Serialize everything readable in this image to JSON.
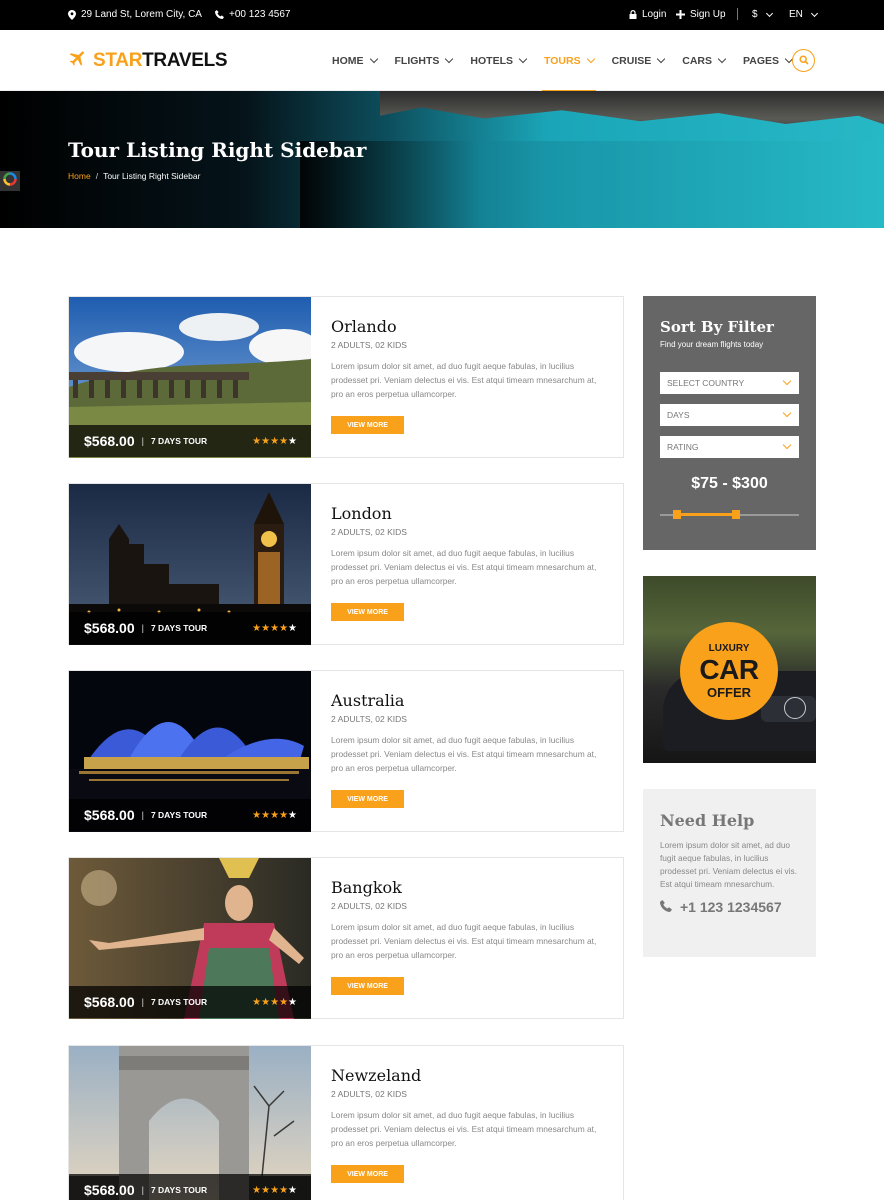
{
  "topbar": {
    "address": "29 Land St, Lorem City, CA",
    "phone": "+00 123 4567",
    "login": "Login",
    "signup": "Sign Up",
    "currency": "$",
    "language": "EN"
  },
  "brand": {
    "part1": "STAR",
    "part2": "TRAVELS"
  },
  "nav": [
    "HOME",
    "FLIGHTS",
    "HOTELS",
    "TOURS",
    "CRUISE",
    "CARS",
    "PAGES"
  ],
  "nav_active": "TOURS",
  "hero": {
    "title": "Tour Listing Right Sidebar",
    "breadcrumb_home": "Home",
    "breadcrumb_sep": "/",
    "breadcrumb_current": "Tour Listing Right Sidebar"
  },
  "tours": [
    {
      "city": "Orlando",
      "guests": "2 ADULTS, 02 KIDS",
      "price": "$568.00",
      "sep": "|",
      "duration": "7 DAYS TOUR",
      "rating": 4,
      "max_rating": 5,
      "button": "VIEW MORE",
      "description": "Lorem ipsum dolor sit amet, ad duo fugit aeque fabulas, in lucilius prodesset pri. Veniam delectus ei vis. Est atqui timeam mnesarchum at, pro an eros perpetua ullamcorper."
    },
    {
      "city": "London",
      "guests": "2 ADULTS, 02 KIDS",
      "price": "$568.00",
      "sep": "|",
      "duration": "7 DAYS TOUR",
      "rating": 4,
      "max_rating": 5,
      "button": "VIEW MORE",
      "description": "Lorem ipsum dolor sit amet, ad duo fugit aeque fabulas, in lucilius prodesset pri. Veniam delectus ei vis. Est atqui timeam mnesarchum at, pro an eros perpetua ullamcorper."
    },
    {
      "city": "Australia",
      "guests": "2 ADULTS, 02 KIDS",
      "price": "$568.00",
      "sep": "|",
      "duration": "7 DAYS TOUR",
      "rating": 4,
      "max_rating": 5,
      "button": "VIEW MORE",
      "description": "Lorem ipsum dolor sit amet, ad duo fugit aeque fabulas, in lucilius prodesset pri. Veniam delectus ei vis. Est atqui timeam mnesarchum at, pro an eros perpetua ullamcorper."
    },
    {
      "city": "Bangkok",
      "guests": "2 ADULTS, 02 KIDS",
      "price": "$568.00",
      "sep": "|",
      "duration": "7 DAYS TOUR",
      "rating": 4,
      "max_rating": 5,
      "button": "VIEW MORE",
      "description": "Lorem ipsum dolor sit amet, ad duo fugit aeque fabulas, in lucilius prodesset pri. Veniam delectus ei vis. Est atqui timeam mnesarchum at, pro an eros perpetua ullamcorper."
    },
    {
      "city": "Newzeland",
      "guests": "2 ADULTS, 02 KIDS",
      "price": "$568.00",
      "sep": "|",
      "duration": "7 DAYS TOUR",
      "rating": 4,
      "max_rating": 5,
      "button": "VIEW MORE",
      "description": "Lorem ipsum dolor sit amet, ad duo fugit aeque fabulas, in lucilius prodesset pri. Veniam delectus ei vis. Est atqui timeam mnesarchum at, pro an eros perpetua ullamcorper."
    }
  ],
  "filter": {
    "title": "Sort By Filter",
    "subtitle": "Find your dream flights today",
    "selects": [
      "SELECT COUNTRY",
      "DAYS",
      "RATING"
    ],
    "price_range": "$75 - $300",
    "range_min_fraction": 0.12,
    "range_max_fraction": 0.55
  },
  "promo": {
    "line1": "LUXURY",
    "line2": "CAR",
    "line3": "OFFER"
  },
  "help": {
    "title": "Need Help",
    "text": "Lorem ipsum dolor sit amet, ad duo fugit aeque fabulas, in lucilius prodesset pri. Veniam delectus ei vis. Est atqui timeam mnesarchum.",
    "phone": "+1 123 1234567"
  },
  "colors": {
    "accent": "#f9a11b",
    "topbar": "#000000",
    "filter_bg": "#666666",
    "help_bg": "#f0f0f0"
  }
}
